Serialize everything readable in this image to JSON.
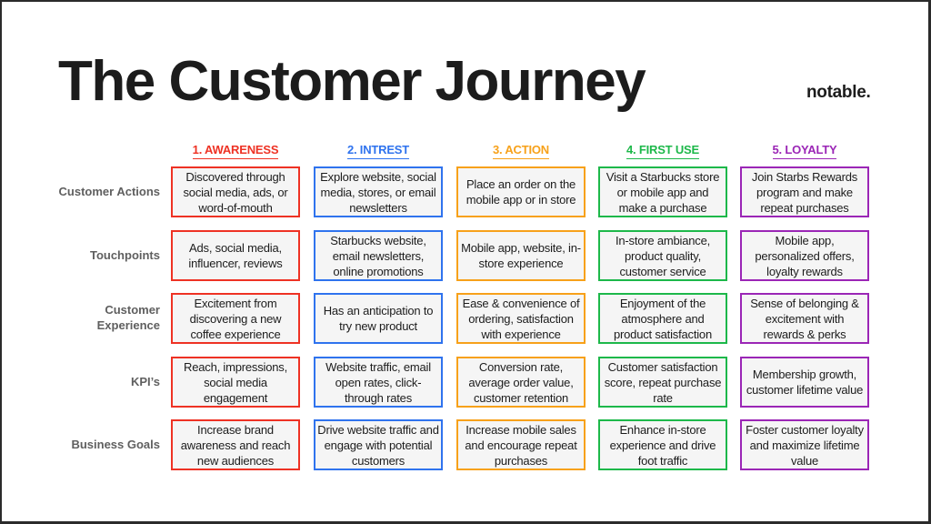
{
  "title": "The Customer Journey",
  "logo": "notable.",
  "colors": {
    "awareness": "#ee3224",
    "interest": "#2f73ee",
    "action": "#f7a11a",
    "first_use": "#1db84a",
    "loyalty": "#9b26b6",
    "frame": "#2b2b2b"
  },
  "stages": [
    {
      "label": "1. AWARENESS",
      "color": "#ee3224"
    },
    {
      "label": "2. INTREST",
      "color": "#2f73ee"
    },
    {
      "label": "3. ACTION",
      "color": "#f7a11a"
    },
    {
      "label": "4. FIRST USE",
      "color": "#1db84a"
    },
    {
      "label": "5. LOYALTY",
      "color": "#9b26b6"
    }
  ],
  "rows": [
    {
      "label": "Customer Actions",
      "cells": [
        "Discovered through social media, ads, or word-of-mouth",
        "Explore website, social media, stores, or email newsletters",
        "Place an order on the mobile app or in store",
        "Visit a Starbucks store or mobile app and make a purchase",
        "Join Starbs Rewards program and  make repeat purchases"
      ]
    },
    {
      "label": "Touchpoints",
      "cells": [
        "Ads, social media, influencer, reviews",
        "Starbucks website, email newsletters, online promotions",
        "Mobile app, website, in-store experience",
        "In-store ambiance, product quality, customer service",
        "Mobile app, personalized offers, loyalty rewards"
      ]
    },
    {
      "label": "Customer Experience",
      "cells": [
        "Excitement from discovering a new coffee experience",
        "Has an anticipation to try new product",
        "Ease & convenience of ordering, satisfaction with experience",
        "Enjoyment of the atmosphere and product satisfaction",
        "Sense of belonging & excitement with rewards & perks"
      ]
    },
    {
      "label": "KPI’s",
      "cells": [
        "Reach, impressions, social media engagement",
        "Website traffic, email open rates, click-through rates",
        "Conversion rate, average order value, customer retention",
        "Customer satisfaction score, repeat purchase rate",
        "Membership growth, customer lifetime value"
      ]
    },
    {
      "label": "Business Goals",
      "cells": [
        "Increase brand awareness and reach new audiences",
        "Drive website traffic and engage with potential customers",
        "Increase mobile sales  and  encourage repeat purchases",
        "Enhance in-store experience and drive foot traffic",
        "Foster customer loyalty and maximize lifetime value"
      ]
    }
  ]
}
